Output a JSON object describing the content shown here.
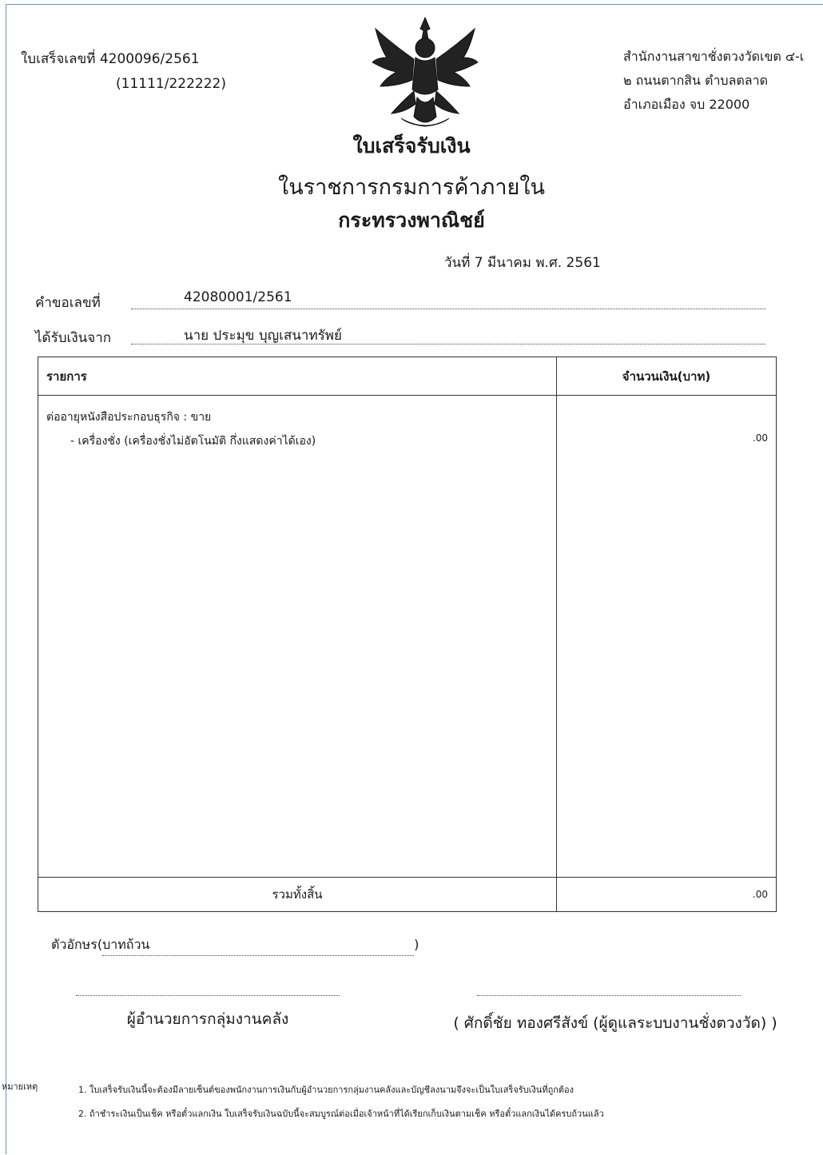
{
  "header": {
    "receipt_no": "ใบเสร็จเลขที่ 4200096/2561",
    "receipt_ref": "(11111/222222)",
    "office_line1": "สำนักงานสาขาชั่งตวงวัดเขต ๔-เ",
    "office_line2": "๒ ถนนตากสิน ตำบลตลาด",
    "office_line3": "อำเภอเมือง จบ 22000"
  },
  "title": {
    "main": "ใบเสร็จรับเงิน",
    "sub": "ในราชการกรมการค้าภายใน",
    "ministry": "กระทรวงพาณิชย์"
  },
  "date": "วันที่ 7 มีนาคม พ.ศ. 2561",
  "request": {
    "label": "คำขอเลขที่",
    "value": "42080001/2561"
  },
  "payer": {
    "label": "ได้รับเงินจาก",
    "value": "นาย ประมุข  บุญเสนาทรัพย์"
  },
  "table": {
    "col_desc": "รายการ",
    "col_amount": "จำนวนเงิน(บาท)",
    "item_title": "ต่ออายุหนังสือประกอบธุรกิจ : ขาย",
    "item_sub": "- เครื่องชั่ง (เครื่องชั่งไม่อัตโนมัติ กึ่งแสดงค่าได้เอง)",
    "item_amount": ".00",
    "total_label": "รวมทั้งสิ้น",
    "total_amount": ".00"
  },
  "amount_words": {
    "prefix": "ตัวอักษร(",
    "value": "บาทถ้วน",
    "suffix": ")"
  },
  "signatures": {
    "left": "ผู้อำนวยการกลุ่มงานคลัง",
    "right": "( ศักดิ์ชัย ทองศรีสังข์ (ผู้ดูแลระบบงานชั่งตวงวัด) )"
  },
  "notes": {
    "label": "หมายเหตุ",
    "line1": "1. ใบเสร็จรับเงินนี้จะต้องมีลายเซ็นต์ของพนักงานการเงินกับผู้อำนวยการกลุ่มงานคลังและบัญชีลงนามจึงจะเป็นใบเสร็จรับเงินที่ถูกต้อง",
    "line2": "2. ถ้าชำระเงินเป็นเช็ค หรือตั๋วแลกเงิน ใบเสร็จรับเงินฉบับนี้จะสมบูรณ์ต่อเมื่อเจ้าหน้าที่ได้เรียกเก็บเงินตามเช็ค หรือตั๋วแลกเงินได้ครบถ้วนแล้ว"
  }
}
